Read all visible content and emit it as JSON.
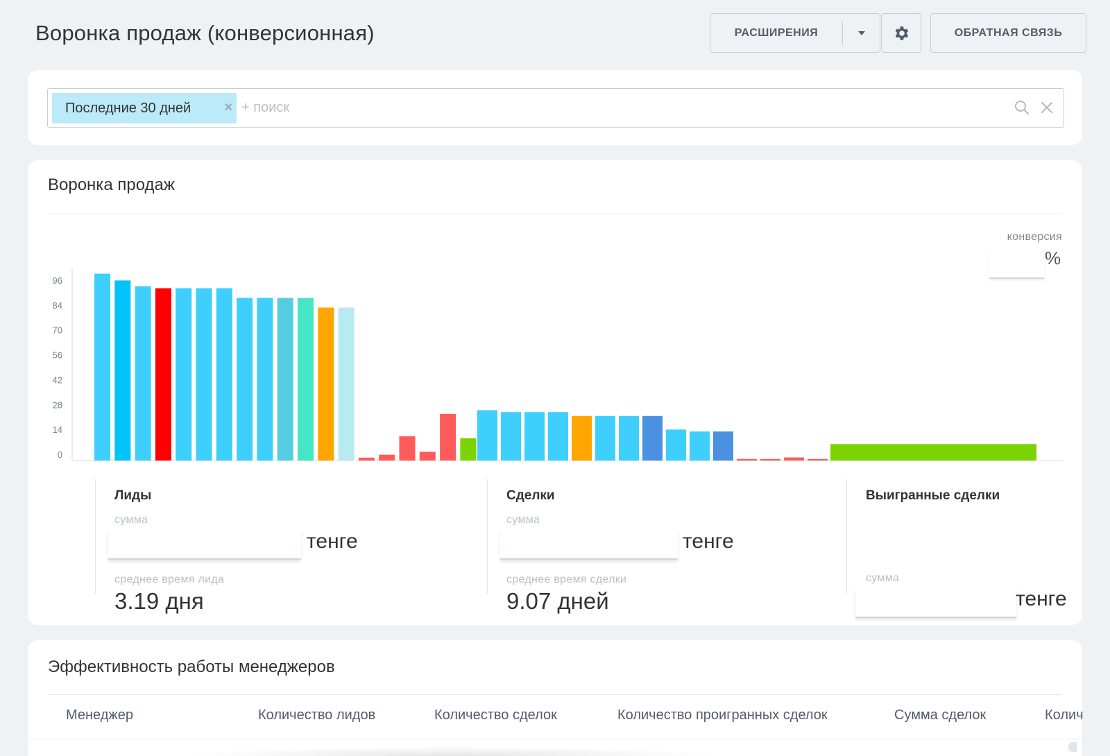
{
  "header": {
    "title": "Воронка продаж (конверсионная)",
    "extensions_label": "РАСШИРЕНИЯ",
    "feedback_label": "ОБРАТНАЯ СВЯЗЬ"
  },
  "filter": {
    "chip_label": "Последние 30 дней",
    "chip_remove": "×",
    "search_placeholder": "+ поиск"
  },
  "funnel": {
    "title": "Воронка продаж",
    "conversion_label": "конверсия",
    "conversion_value": "",
    "conversion_unit": "%",
    "stats": [
      {
        "title": "Лиды",
        "sum_label": "сумма",
        "sum_value": "",
        "currency": "тенге",
        "avg_label": "среднее время лида",
        "avg_value": "3.19 дня"
      },
      {
        "title": "Сделки",
        "sum_label": "сумма",
        "sum_value": "",
        "currency": "тенге",
        "avg_label": "среднее время сделки",
        "avg_value": "9.07 дней"
      },
      {
        "title": "Выигранные сделки",
        "sum_label": "сумма",
        "sum_value": "",
        "currency": "тенге"
      }
    ]
  },
  "managers": {
    "title": "Эффективность работы менеджеров",
    "columns": [
      "Менеджер",
      "Количество лидов",
      "Количество сделок",
      "Количество проигранных сделок",
      "Сумма сделок",
      "Колич"
    ]
  },
  "chart_data": {
    "type": "bar",
    "yticks": [
      "96",
      "84",
      "70",
      "56",
      "42",
      "28",
      "14",
      "0"
    ],
    "ylim": [
      0,
      96
    ],
    "groups": [
      {
        "name": "Лиды",
        "values": [
          96.5,
          93,
          90,
          89,
          89,
          89,
          89,
          84,
          84,
          84,
          84,
          79,
          79,
          1.5,
          3,
          12.5,
          4.5,
          24,
          11.5
        ],
        "colors": [
          "#3ecffc",
          "#03c3fb",
          "#3ecffc",
          "#fe0000",
          "#3ecffc",
          "#3ecffc",
          "#3ecffc",
          "#3ecffc",
          "#3ecffc",
          "#55cde0",
          "#46e5c6",
          "#fea500",
          "#b8ebf1",
          "#fe5b5a",
          "#fe5b5a",
          "#fe5b5a",
          "#fe5b5a",
          "#fe5b5a",
          "#7bd400"
        ]
      },
      {
        "name": "Сделки",
        "values": [
          26,
          25,
          25,
          25,
          23,
          23,
          23,
          23,
          16,
          15,
          15,
          0.8,
          0.8,
          1.6,
          0.8
        ],
        "colors": [
          "#3ecffc",
          "#3ecffc",
          "#3ecffc",
          "#3ecffc",
          "#fea500",
          "#3ecffc",
          "#3ecffc",
          "#4a91e1",
          "#3ecffc",
          "#3ecffc",
          "#4a91e1",
          "#fe5b5a",
          "#fe5b5a",
          "#fe5b5a",
          "#fe5b5a"
        ]
      },
      {
        "name": "Выигранные сделки",
        "values": [
          8.5
        ],
        "colors": [
          "#7bd400"
        ]
      }
    ]
  }
}
